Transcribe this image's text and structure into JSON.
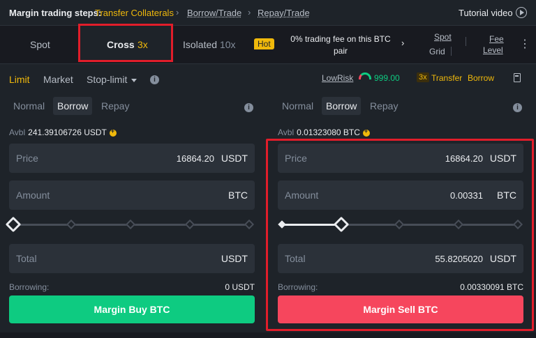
{
  "steps": {
    "label": "Margin trading steps:",
    "items": [
      "Transfer Collaterals",
      "Borrow/Trade",
      "Repay/Trade"
    ],
    "tutorial": "Tutorial video"
  },
  "tabs": {
    "spot": "Spot",
    "cross": "Cross",
    "cross_mult": "3x",
    "isolated": "Isolated",
    "isolated_mult": "10x",
    "hot": "Hot",
    "promo": "0% trading fee on this BTC pair",
    "spot_grid_1": "Spot",
    "spot_grid_2": "Grid",
    "fee_1": "Fee",
    "fee_2": "Level"
  },
  "order_types": {
    "limit": "Limit",
    "market": "Market",
    "stop_limit": "Stop-limit",
    "low_risk": "LowRisk",
    "risk_value": "999.00",
    "mult": "3x",
    "transfer": "Transfer",
    "borrow": "Borrow"
  },
  "buy": {
    "modes": [
      "Normal",
      "Borrow",
      "Repay"
    ],
    "active_mode": "Borrow",
    "avbl_label": "Avbl",
    "avbl_value": "241.39106726 USDT",
    "price_label": "Price",
    "price_value": "16864.20",
    "price_unit": "USDT",
    "amount_label": "Amount",
    "amount_value": "",
    "amount_unit": "BTC",
    "slider_percent": 0,
    "total_label": "Total",
    "total_value": "",
    "total_unit": "USDT",
    "borrowing_label": "Borrowing:",
    "borrowing_value": "0 USDT",
    "button": "Margin Buy BTC"
  },
  "sell": {
    "modes": [
      "Normal",
      "Borrow",
      "Repay"
    ],
    "active_mode": "Borrow",
    "avbl_label": "Avbl",
    "avbl_value": "0.01323080 BTC",
    "price_label": "Price",
    "price_value": "16864.20",
    "price_unit": "USDT",
    "amount_label": "Amount",
    "amount_value": "0.00331",
    "amount_unit": "BTC",
    "slider_percent": 25,
    "total_label": "Total",
    "total_value": "55.8205020",
    "total_unit": "USDT",
    "borrowing_label": "Borrowing:",
    "borrowing_value": "0.00330091 BTC",
    "button": "Margin Sell BTC"
  },
  "colors": {
    "accent": "#f0b90b",
    "buy": "#0ecb81",
    "sell": "#f6465d",
    "highlight": "#e11d2a"
  }
}
